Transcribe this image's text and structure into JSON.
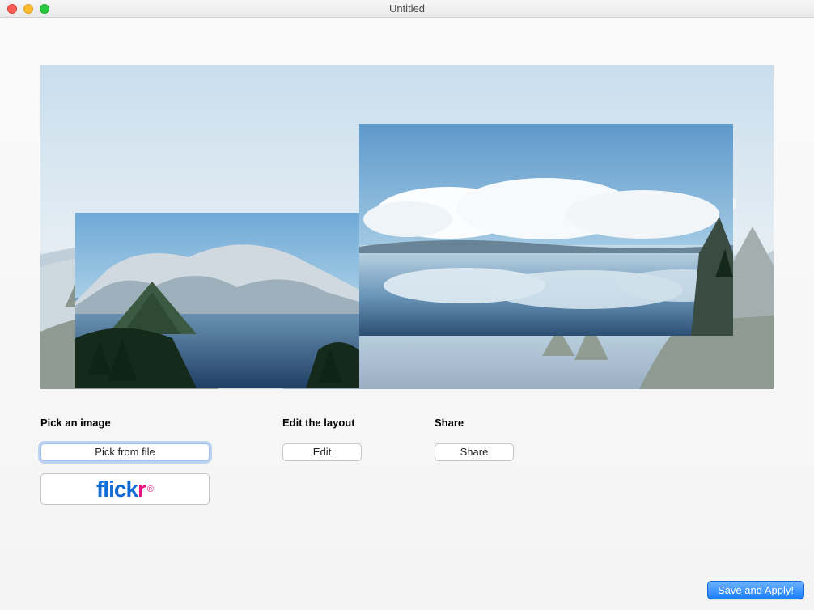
{
  "window": {
    "title": "Untitled"
  },
  "sections": {
    "pick": {
      "heading": "Pick an image",
      "pick_from_file_label": "Pick from file",
      "flickr_label": "flickr"
    },
    "edit": {
      "heading": "Edit the layout",
      "button_label": "Edit"
    },
    "share": {
      "heading": "Share",
      "button_label": "Share"
    }
  },
  "footer": {
    "save_apply_label": "Save and Apply!"
  }
}
